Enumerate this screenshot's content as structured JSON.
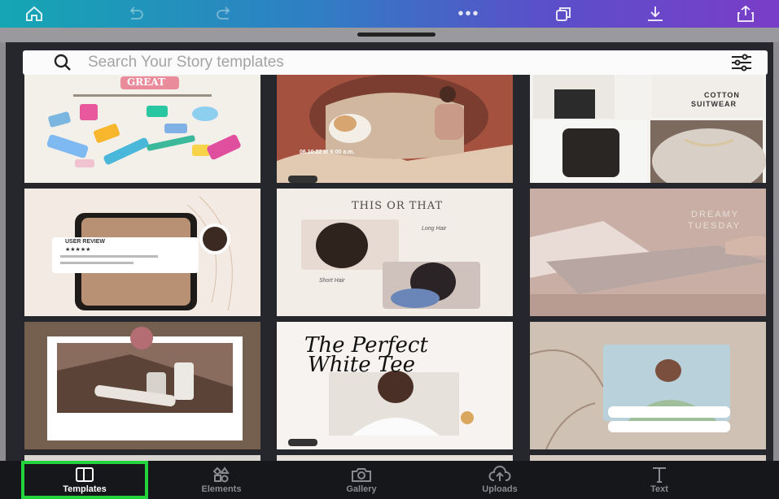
{
  "toolbar": {
    "icons": [
      "home-icon",
      "undo-icon",
      "redo-icon",
      "more-icon",
      "copy-pages-icon",
      "download-icon",
      "share-icon"
    ],
    "more_label": "•••"
  },
  "search": {
    "placeholder": "Search Your Story templates"
  },
  "templates": [
    {
      "texts": [
        "GREAT"
      ]
    },
    {
      "texts": [
        "06.10.22 at 6:00 a.m."
      ]
    },
    {
      "texts": [
        "COTTON",
        "SUITWEAR"
      ]
    },
    {
      "texts": [
        "USER REVIEW",
        "★★★★★"
      ]
    },
    {
      "texts": [
        "THIS OR THAT",
        "Long Hair",
        "Short Hair"
      ]
    },
    {
      "texts": [
        "DREAMY",
        "TUESDAY"
      ]
    },
    {
      "texts": []
    },
    {
      "texts": [
        "The Perfect",
        "White Tee"
      ]
    },
    {
      "texts": []
    }
  ],
  "bottom_nav": {
    "items": [
      {
        "label": "Templates",
        "icon": "templates-icon",
        "active": true
      },
      {
        "label": "Elements",
        "icon": "elements-icon",
        "active": false
      },
      {
        "label": "Gallery",
        "icon": "gallery-icon",
        "active": false
      },
      {
        "label": "Uploads",
        "icon": "uploads-icon",
        "active": false
      },
      {
        "label": "Text",
        "icon": "text-icon",
        "active": false
      }
    ]
  },
  "colors": {
    "active_highlight": "#22d33b",
    "toolbar_gradient_start": "#14a6b3",
    "toolbar_gradient_end": "#7a3dc8"
  }
}
